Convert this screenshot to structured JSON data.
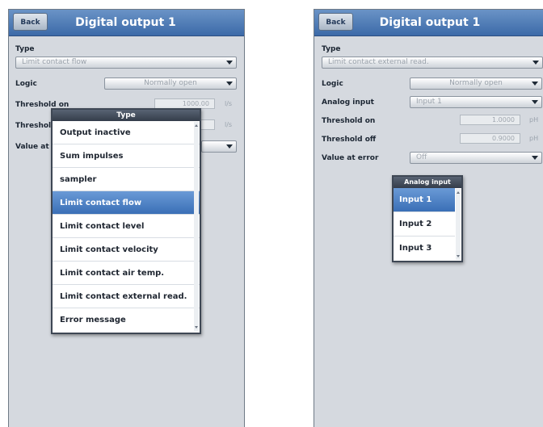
{
  "left": {
    "back_label": "Back",
    "title": "Digital output 1",
    "type_label": "Type",
    "type_value": "Limit contact flow",
    "logic_label": "Logic",
    "logic_value": "Normally open",
    "threshold_on_label": "Threshold on",
    "threshold_on_value": "1000.00",
    "threshold_on_unit": "l/s",
    "threshold_off_label": "Threshold off",
    "threshold_off_unit": "l/s",
    "value_at_error_label": "Value at error",
    "popup": {
      "title": "Type",
      "items": [
        {
          "label": "Output inactive"
        },
        {
          "label": "Sum impulses"
        },
        {
          "label": "sampler"
        },
        {
          "label": "Limit contact flow"
        },
        {
          "label": "Limit contact level"
        },
        {
          "label": "Limit contact velocity"
        },
        {
          "label": "Limit contact air temp."
        },
        {
          "label": "Limit contact external read."
        },
        {
          "label": "Error message"
        }
      ],
      "selected": "Limit contact flow"
    }
  },
  "right": {
    "back_label": "Back",
    "title": "Digital output 1",
    "type_label": "Type",
    "type_value": "Limit contact external read.",
    "logic_label": "Logic",
    "logic_value": "Normally open",
    "analog_input_label": "Analog input",
    "analog_input_value": "Input 1",
    "threshold_on_label": "Threshold on",
    "threshold_on_value": "1.0000",
    "threshold_on_unit": "pH",
    "threshold_off_label": "Threshold off",
    "threshold_off_value": "0.9000",
    "threshold_off_unit": "pH",
    "value_at_error_label": "Value at error",
    "value_at_error_value": "Off",
    "popup": {
      "title": "Analog input",
      "items": [
        {
          "label": "Input 1"
        },
        {
          "label": "Input 2"
        },
        {
          "label": "Input 3"
        }
      ],
      "selected": "Input 1"
    }
  },
  "colors": {
    "titlebar": "#4a78b5",
    "selection": "#4a7fc4",
    "popup_header": "#3f4856"
  }
}
